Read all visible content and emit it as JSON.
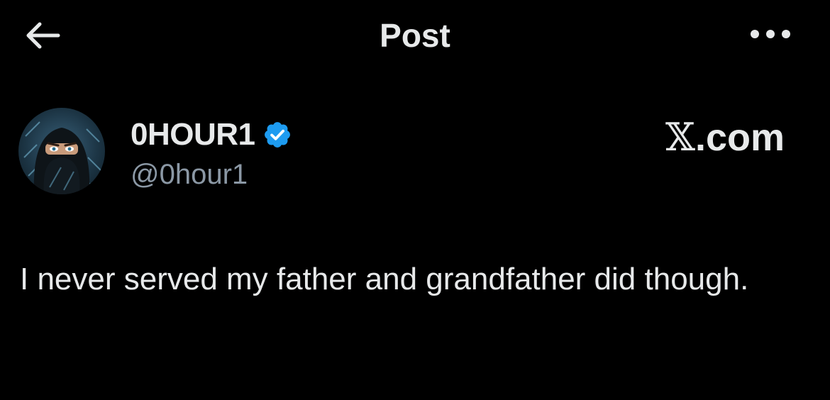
{
  "header": {
    "title": "Post",
    "back_icon": "arrow-left-icon",
    "more_icon": "more-horizontal-icon"
  },
  "author": {
    "display_name": "0HOUR1",
    "handle": "@0hour1",
    "verified": true,
    "verified_icon": "verified-badge-icon",
    "verified_color": "#1d9bf0"
  },
  "source": {
    "mark": "𝕏",
    "domain": ".com"
  },
  "post": {
    "text": "I never served my father and grandfather did though."
  },
  "colors": {
    "background": "#000000",
    "text_primary": "#e7e9ea",
    "text_secondary": "#8b98a5"
  }
}
